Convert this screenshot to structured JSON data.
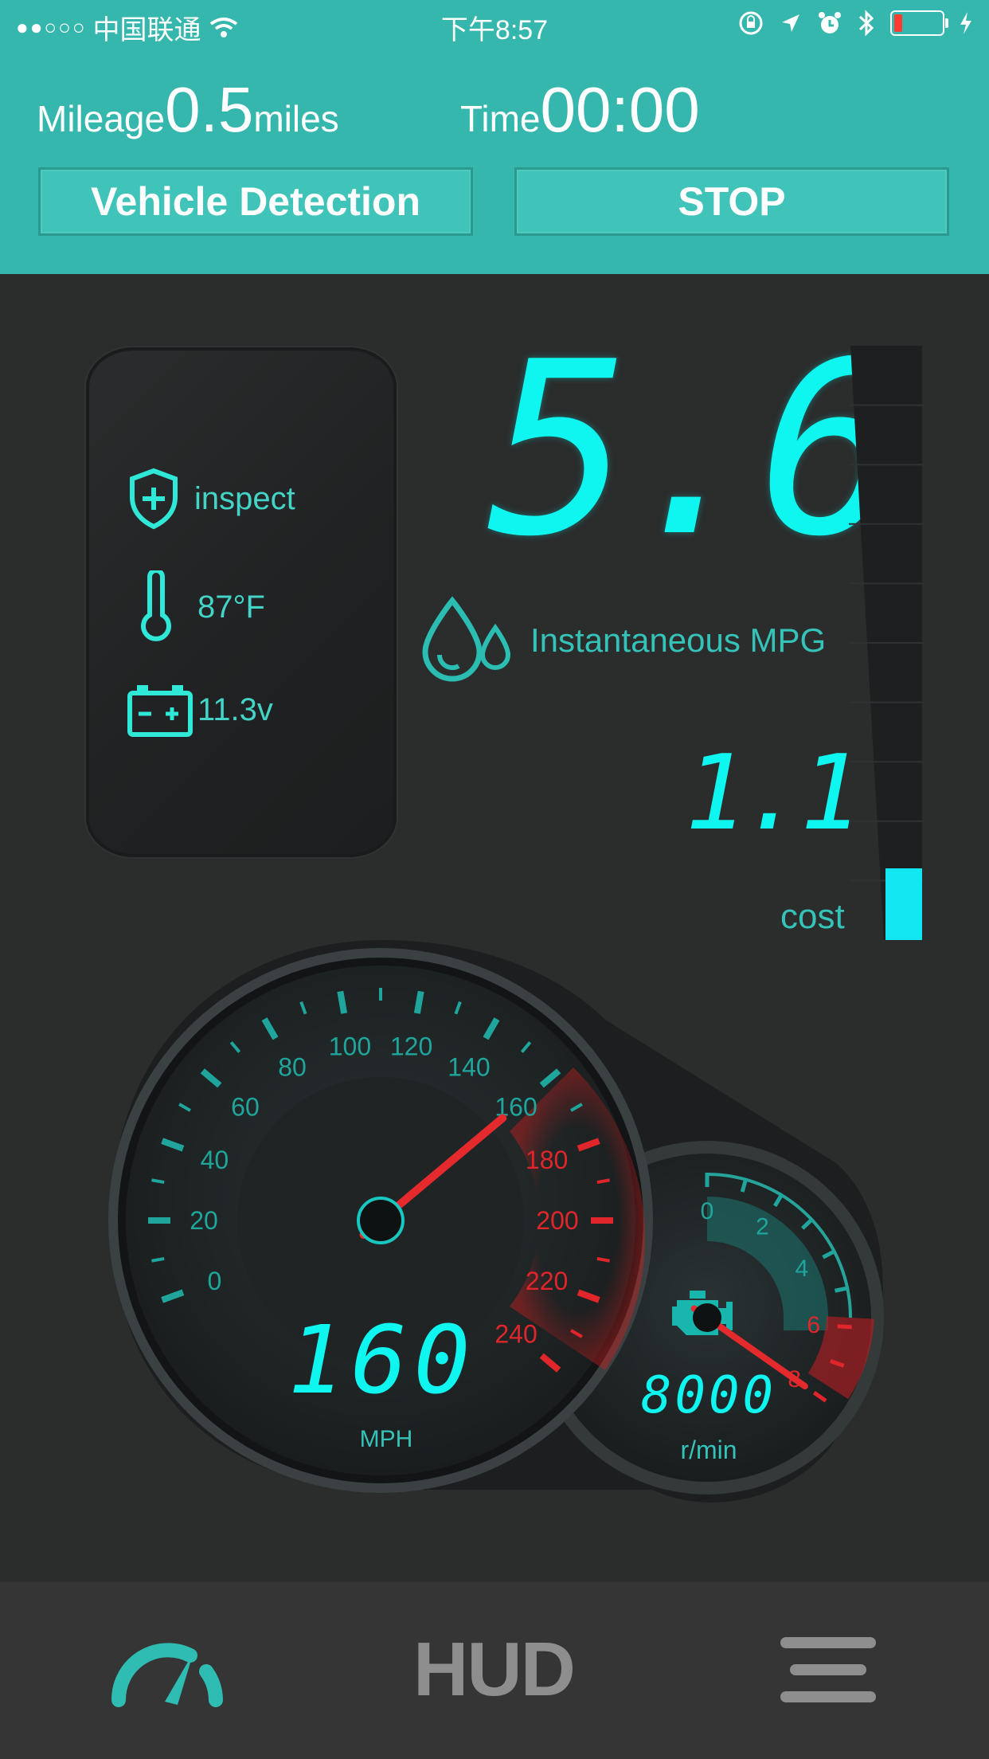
{
  "status_bar": {
    "carrier": "中国联通",
    "time": "下午8:57"
  },
  "trip": {
    "mileage_label": "Mileage",
    "mileage_value": "0.5",
    "mileage_unit": "miles",
    "time_label": "Time",
    "time_value": "00:00"
  },
  "buttons": {
    "vehicle_detection": "Vehicle Detection",
    "stop": "STOP"
  },
  "info": {
    "inspect": "inspect",
    "temperature": "87°F",
    "voltage": "11.3v"
  },
  "mpg": {
    "value": "5.6",
    "label": "Instantaneous MPG",
    "cost_value": "1.1",
    "cost_label": "cost",
    "cost_level_fraction": 0.12
  },
  "speedometer": {
    "value": "160",
    "unit": "MPH",
    "ticks": [
      "0",
      "20",
      "40",
      "60",
      "80",
      "100",
      "120",
      "140",
      "160",
      "180",
      "200",
      "220",
      "240"
    ],
    "needle_value": 160
  },
  "tachometer": {
    "value": "8000",
    "unit": "r/min",
    "ticks": [
      "0",
      "2",
      "4",
      "6",
      "8"
    ],
    "needle_value": 8
  },
  "tabbar": {
    "hud_label": "HUD"
  },
  "colors": {
    "accent": "#35b7ad",
    "digital": "#0ff5f0",
    "redline": "#e0262b",
    "background": "#2b2d2d"
  }
}
